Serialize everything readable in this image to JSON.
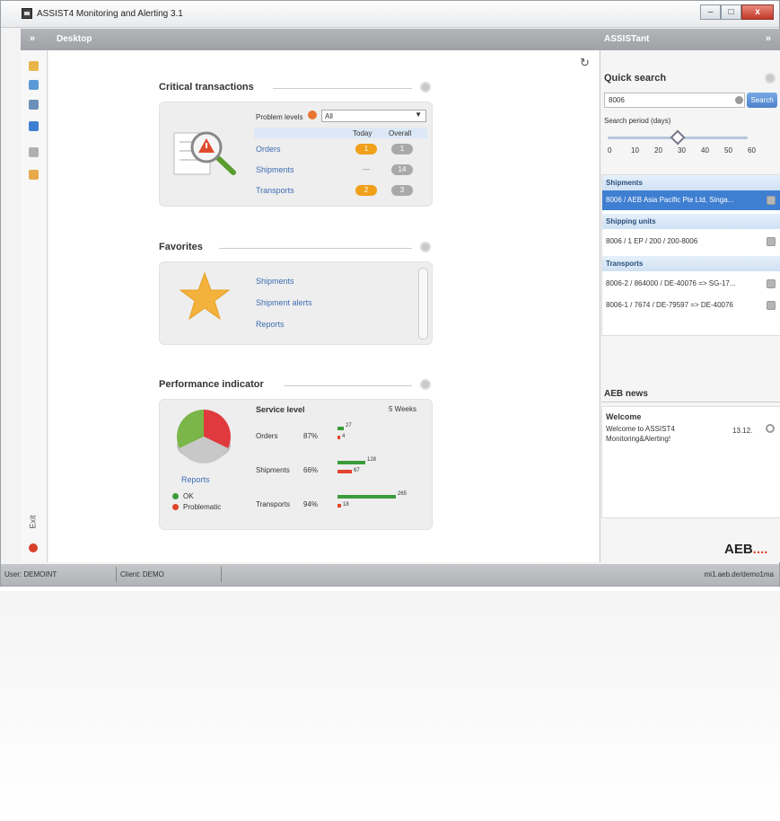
{
  "window": {
    "title": "ASSIST4 Monitoring and Alerting 3.1",
    "minimize_glyph": "–",
    "maximize_glyph": "□",
    "close_glyph": "x"
  },
  "sidebar": {
    "toggle_glyph": "»",
    "title": "Desktop"
  },
  "assistant": {
    "title": "ASSISTant",
    "toggle_glyph": "»"
  },
  "leftbar": {
    "exit_label": "Exit"
  },
  "desktop": {
    "refresh_glyph": "↻",
    "critical": {
      "title": "Critical transactions",
      "problem_levels_label": "Problem levels",
      "problem_levels_value": "All",
      "col_today": "Today",
      "col_overall": "Overall",
      "rows": [
        {
          "label": "Orders",
          "today": "1",
          "overall": "1"
        },
        {
          "label": "Shipments",
          "today": "—",
          "overall": "14"
        },
        {
          "label": "Transports",
          "today": "2",
          "overall": "3"
        }
      ]
    },
    "favorites": {
      "title": "Favorites",
      "items": [
        "Shipments",
        "Shipment alerts",
        "Reports"
      ]
    },
    "performance": {
      "title": "Performance indicator",
      "service_level": "Service level",
      "period": "5 Weeks",
      "rows": [
        {
          "label": "Orders",
          "pct": "87%",
          "ok": 27,
          "problem": 4
        },
        {
          "label": "Shipments",
          "pct": "66%",
          "ok": 128,
          "problem": 67
        },
        {
          "label": "Transports",
          "pct": "94%",
          "ok": 265,
          "problem": 18
        }
      ],
      "reports_link": "Reports",
      "legend_ok": "OK",
      "legend_problem": "Problematic",
      "pie": {
        "ok_color": "#7ab648",
        "problem_color": "#e0393e",
        "neutral_color": "#c8c8c8"
      }
    }
  },
  "quick_search": {
    "title": "Quick search",
    "input_value": "8006",
    "search_button": "Search",
    "period_label": "Search period (days)",
    "ticks": [
      "0",
      "10",
      "20",
      "30",
      "40",
      "50",
      "60"
    ],
    "selected_days": 30,
    "max_days": 60
  },
  "results": {
    "shipments_header": "Shipments",
    "shipments": [
      "8006 / AEB Asia Pacific Pte Ltd, Singa..."
    ],
    "shipping_units_header": "Shipping units",
    "shipping_units": [
      "8006 / 1 EP / 200 / 200-8006"
    ],
    "transports_header": "Transports",
    "transports": [
      "8006-2 / 864000 / DE-40076 => SG-17...",
      "8006-1 / 7674 / DE-79597 => DE-40076"
    ]
  },
  "news": {
    "title": "AEB news",
    "headline": "Welcome",
    "body": "Welcome to ASSIST4 Monitoring&Alerting!",
    "date": "13.12."
  },
  "branding": {
    "logo": "AEB",
    "logo_dots": "....",
    "accent": "#e3442b"
  },
  "statusbar": {
    "user": "User: DEMOINT",
    "client": "Client: DEMO",
    "url": "mi1.aeb.de/demo1ma"
  }
}
